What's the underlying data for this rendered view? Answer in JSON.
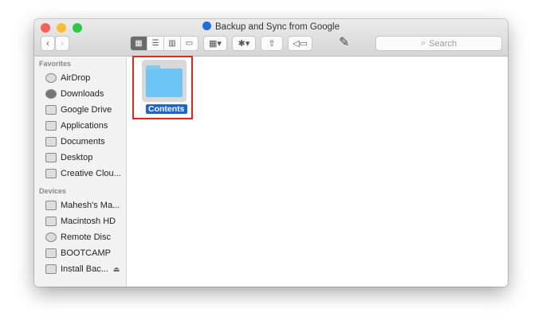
{
  "window": {
    "title": "Backup and Sync from Google"
  },
  "toolbar": {
    "back": "‹",
    "forward": "›",
    "views": [
      "icon",
      "list",
      "column",
      "cover-flow"
    ],
    "search_placeholder": "Search"
  },
  "sidebar": {
    "favorites_header": "Favorites",
    "favorites": [
      {
        "label": "AirDrop"
      },
      {
        "label": "Downloads"
      },
      {
        "label": "Google Drive"
      },
      {
        "label": "Applications"
      },
      {
        "label": "Documents"
      },
      {
        "label": "Desktop"
      },
      {
        "label": "Creative Clou..."
      }
    ],
    "devices_header": "Devices",
    "devices": [
      {
        "label": "Mahesh's Ma..."
      },
      {
        "label": "Macintosh HD"
      },
      {
        "label": "Remote Disc"
      },
      {
        "label": "BOOTCAMP"
      },
      {
        "label": "Install Bac..."
      }
    ]
  },
  "content": {
    "items": [
      {
        "label": "Contents",
        "selected": true
      }
    ]
  },
  "colors": {
    "selection": "#1a63d8",
    "highlight_box": "#e8231a",
    "folder": "#6cc4f5"
  }
}
